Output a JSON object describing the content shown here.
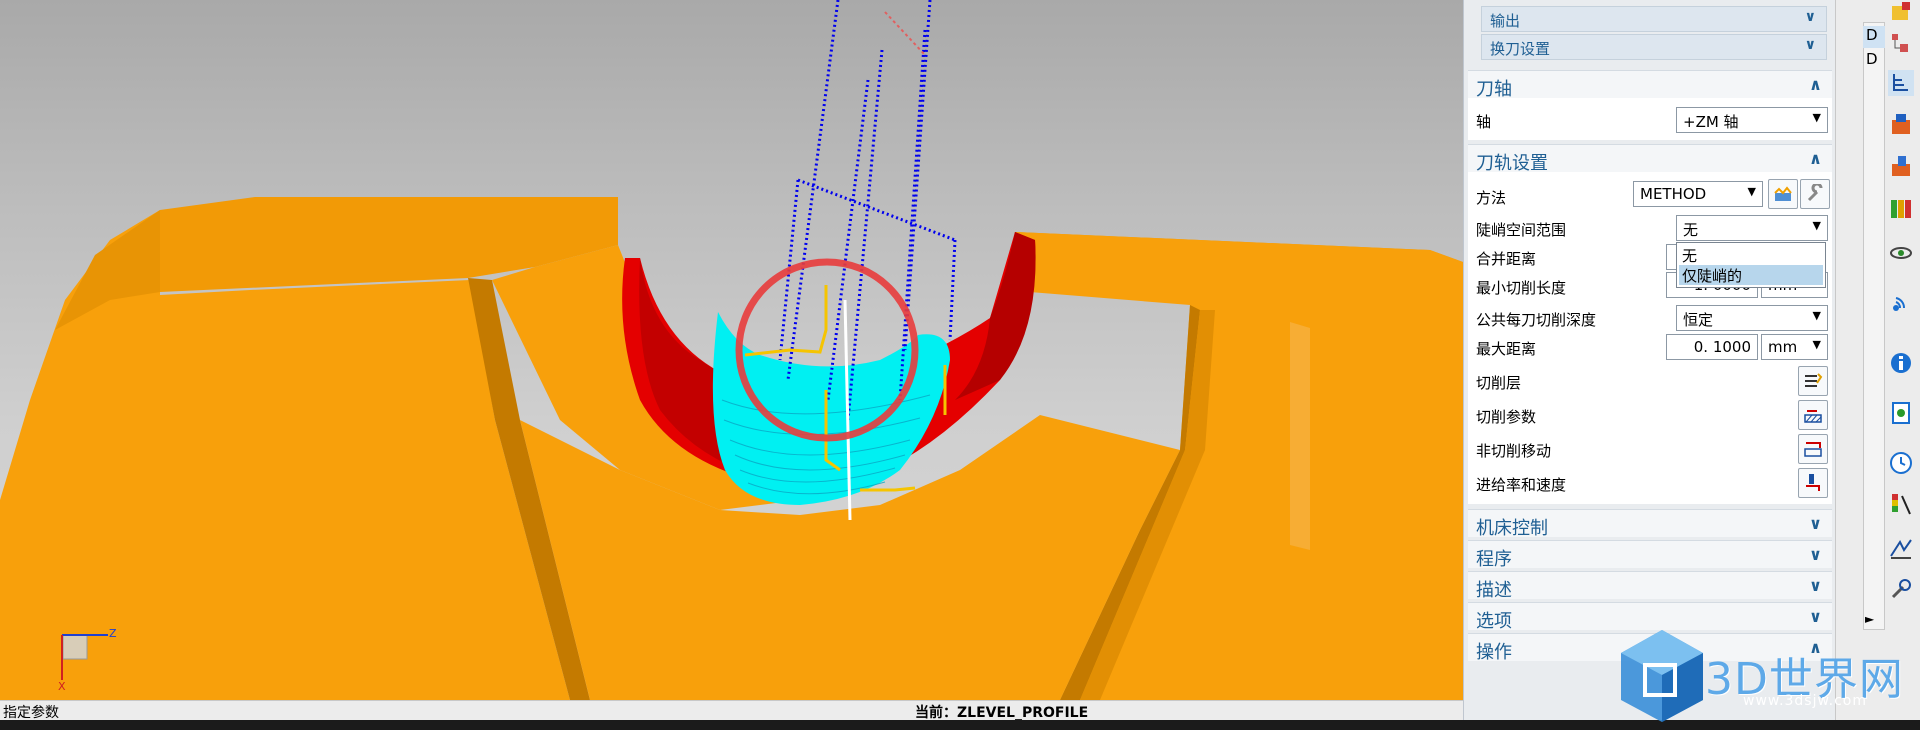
{
  "viewport": {
    "triad": {
      "z_label": "Z",
      "x_label": "X"
    },
    "hint_text": "",
    "colors": {
      "background_top": "#a9a9a9",
      "part": "#f8a00b",
      "part_dark": "#c07800",
      "wall": "#e40000",
      "toolpath_fill": "#00f0f2",
      "blue_path": "#0000ee",
      "yellow_path": "#f5c400",
      "highlight_circle": "#e83c3c"
    }
  },
  "status": {
    "left": "指定参数",
    "center": "当前：ZLEVEL_PROFILE"
  },
  "panel": {
    "sub_headers": [
      {
        "label": "输出",
        "icon": "chevron-down-icon"
      },
      {
        "label": "换刀设置",
        "icon": "chevron-down-icon"
      }
    ],
    "tool_axis": {
      "title": "刀轴",
      "axis_label": "轴",
      "axis_value": "+ZM 轴"
    },
    "path_settings": {
      "title": "刀轨设置",
      "method_label": "方法",
      "method_value": "METHOD",
      "steep_label": "陡峭空间范围",
      "steep_value": "无",
      "steep_options": [
        "无",
        "仅陡峭的"
      ],
      "merge_label": "合并距离",
      "min_cut_label": "最小切削长度",
      "min_cut_value": "1. 0000",
      "min_cut_unit": "mm",
      "depth_label": "公共每刀切削深度",
      "depth_value": "恒定",
      "max_dist_label": "最大距离",
      "max_dist_value": "0. 1000",
      "max_dist_unit": "mm",
      "cut_levels_label": "切削层",
      "cut_params_label": "切削参数",
      "non_cut_label": "非切削移动",
      "feeds_label": "进给率和速度"
    },
    "collapsed_sections": [
      "机床控制",
      "程序",
      "描述",
      "选项",
      "操作"
    ]
  },
  "nav_tabs": [
    "D",
    "D"
  ],
  "toolbar_icons": [
    "part-navigator-icon",
    "assembly-navigator-icon",
    "operation-navigator-icon",
    "machine-tool-icon",
    "tool-library-icon",
    "book-icon",
    "eye-icon",
    "signal-icon",
    "info-icon",
    "document-icon",
    "clock-icon",
    "color-scale-icon",
    "measure-icon",
    "wrench-icon"
  ],
  "watermark": {
    "brand": "3D世界网",
    "url": "www.3dsjw.com"
  }
}
